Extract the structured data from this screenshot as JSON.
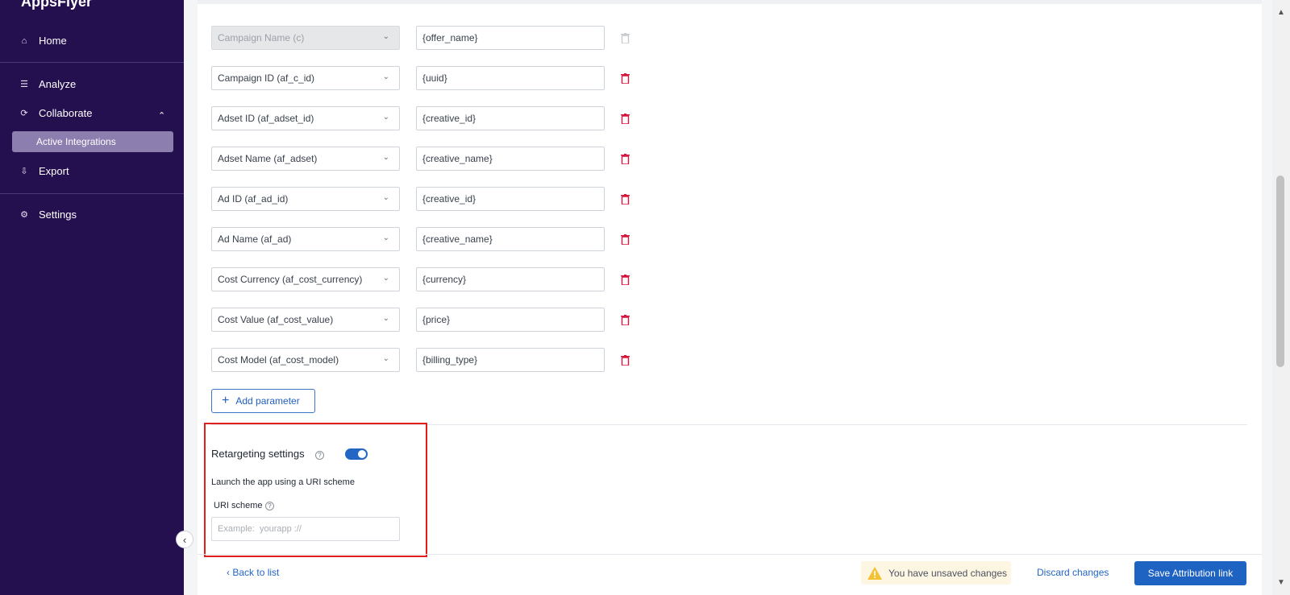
{
  "sidebar": {
    "logo": "AppsFlyer",
    "items": [
      {
        "label": "Home",
        "icon": "home-icon"
      },
      {
        "label": "Analyze",
        "icon": "analyze-icon"
      },
      {
        "label": "Collaborate",
        "icon": "collaborate-icon"
      },
      {
        "label": "Export",
        "icon": "export-icon"
      },
      {
        "label": "Settings",
        "icon": "gear-icon"
      }
    ],
    "active_subitem": "Active Integrations"
  },
  "parameters": [
    {
      "param": "Campaign Name (c)",
      "value": "{offer_name}",
      "disabled": true
    },
    {
      "param": "Campaign ID (af_c_id)",
      "value": "{uuid}",
      "disabled": false
    },
    {
      "param": "Adset ID (af_adset_id)",
      "value": "{creative_id}",
      "disabled": false
    },
    {
      "param": "Adset Name (af_adset)",
      "value": "{creative_name}",
      "disabled": false
    },
    {
      "param": "Ad ID (af_ad_id)",
      "value": "{creative_id}",
      "disabled": false
    },
    {
      "param": "Ad Name (af_ad)",
      "value": "{creative_name}",
      "disabled": false
    },
    {
      "param": "Cost Currency (af_cost_currency)",
      "value": "{currency}",
      "disabled": false
    },
    {
      "param": "Cost Value (af_cost_value)",
      "value": "{price}",
      "disabled": false
    },
    {
      "param": "Cost Model (af_cost_model)",
      "value": "{billing_type}",
      "disabled": false
    }
  ],
  "add_parameter_label": "Add parameter",
  "retargeting": {
    "title": "Retargeting settings",
    "enabled": true,
    "launch_text": "Launch the app using a URI scheme",
    "uri_label": "URI scheme",
    "uri_placeholder": "Example:  yourapp ://"
  },
  "footer": {
    "back_label": "Back to list",
    "warning": "You have unsaved changes",
    "discard_label": "Discard changes",
    "save_label": "Save Attribution link"
  },
  "colors": {
    "sidebar_bg": "#25104f",
    "primary": "#1f63c2",
    "delete": "#d6163c",
    "highlight_border": "#e11d1d",
    "warning_bg": "#fdf6e3"
  }
}
